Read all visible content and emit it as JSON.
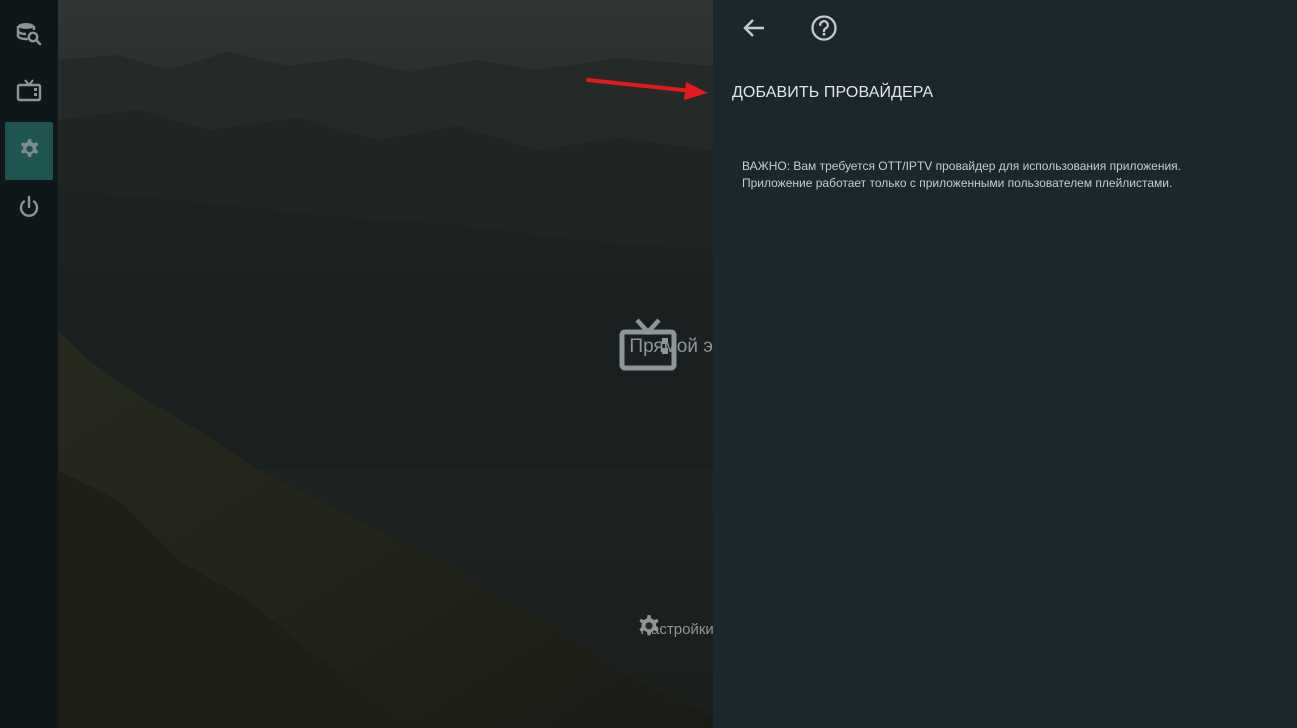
{
  "rail": {
    "items": [
      {
        "icon": "database-search-icon"
      },
      {
        "icon": "tv-icon"
      },
      {
        "icon": "gear-icon",
        "active": true
      },
      {
        "icon": "power-icon"
      }
    ],
    "accent_color": "#1e5550"
  },
  "home": {
    "live_tile_label": "Прямой эф",
    "settings_tile_label": "Настройки"
  },
  "panel": {
    "back_icon": "arrow-left-icon",
    "help_icon": "help-circle-icon",
    "title": "ДОБАВИТЬ ПРОВАЙДЕРА",
    "note_line1": "ВАЖНО: Вам требуется OTT/IPTV провайдер для использования приложения.",
    "note_line2": "Приложение работает только с приложенными пользователем плейлистами.",
    "background_color": "#1b262d"
  },
  "annotation": {
    "color": "#e11b1b",
    "icon": "red-arrow-pointer"
  }
}
